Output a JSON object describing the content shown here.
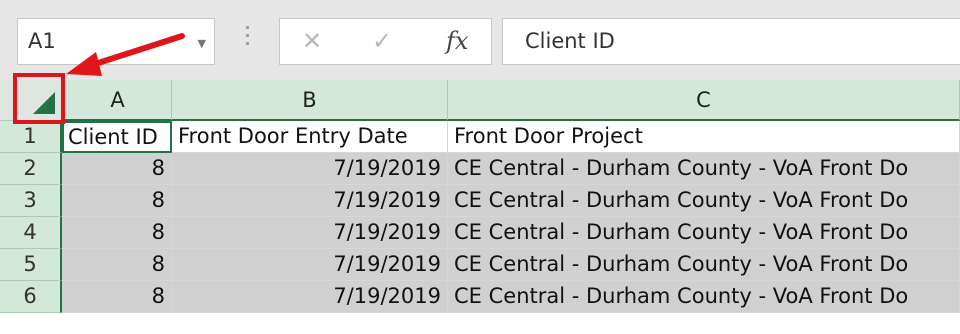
{
  "formula_bar": {
    "name_box": "A1",
    "cancel_icon": "close-icon",
    "enter_icon": "check-icon",
    "fx_label": "fx",
    "content": "Client ID"
  },
  "columns": [
    "A",
    "B",
    "C"
  ],
  "rows": [
    "1",
    "2",
    "3",
    "4",
    "5",
    "6"
  ],
  "headers": {
    "a": "Client ID",
    "b": "Front Door Entry Date",
    "c": "Front Door Project"
  },
  "data_rows": [
    {
      "a": "8",
      "b": "7/19/2019",
      "c": "CE Central - Durham County - VoA Front Do"
    },
    {
      "a": "8",
      "b": "7/19/2019",
      "c": "CE Central - Durham County - VoA Front Do"
    },
    {
      "a": "8",
      "b": "7/19/2019",
      "c": "CE Central - Durham County - VoA Front Do"
    },
    {
      "a": "8",
      "b": "7/19/2019",
      "c": "CE Central - Durham County - VoA Front Do"
    },
    {
      "a": "8",
      "b": "7/19/2019",
      "c": "CE Central - Durham County - VoA Front Do"
    }
  ],
  "annotation": {
    "color": "#e0141b",
    "target": "select-all-button"
  },
  "accent": "#217346"
}
